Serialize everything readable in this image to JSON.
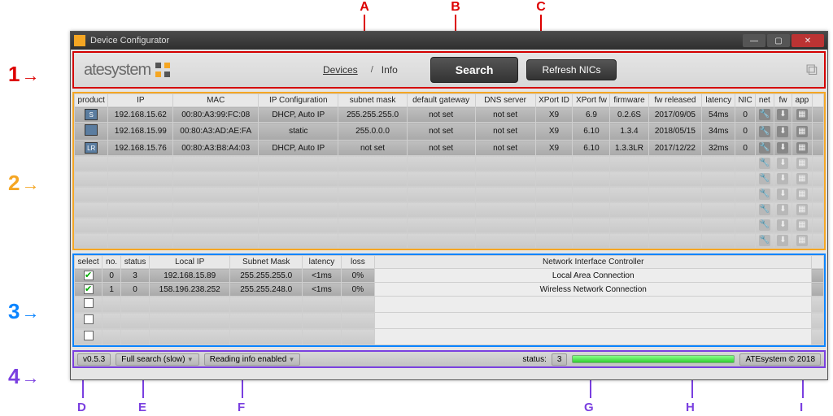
{
  "window": {
    "title": "Device Configurator"
  },
  "header": {
    "logo_text": "atesystem",
    "devices_label": "Devices",
    "info_label": "Info",
    "search_label": "Search",
    "refresh_label": "Refresh NICs"
  },
  "dev_columns": [
    "product",
    "IP",
    "MAC",
    "IP Configuration",
    "subnet mask",
    "default gateway",
    "DNS server",
    "XPort ID",
    "XPort fw",
    "firmware",
    "fw released",
    "latency",
    "NIC",
    "net",
    "fw",
    "app"
  ],
  "devices": [
    {
      "icon": "S",
      "ip": "192.168.15.62",
      "mac": "00:80:A3:99:FC:08",
      "cfg": "DHCP, Auto IP",
      "mask": "255.255.255.0",
      "gw": "not set",
      "dns": "not set",
      "xid": "X9",
      "xfw": "6.9",
      "fw": "0.2.6S",
      "rel": "2017/09/05",
      "lat": "54ms",
      "nic": "0"
    },
    {
      "icon": "",
      "ip": "192.168.15.99",
      "mac": "00:80:A3:AD:AE:FA",
      "cfg": "static",
      "mask": "255.0.0.0",
      "gw": "not set",
      "dns": "not set",
      "xid": "X9",
      "xfw": "6.10",
      "fw": "1.3.4",
      "rel": "2018/05/15",
      "lat": "34ms",
      "nic": "0"
    },
    {
      "icon": "LR",
      "ip": "192.168.15.76",
      "mac": "00:80:A3:B8:A4:03",
      "cfg": "DHCP, Auto IP",
      "mask": "not set",
      "gw": "not set",
      "dns": "not set",
      "xid": "X9",
      "xfw": "6.10",
      "fw": "1.3.3LR",
      "rel": "2017/12/22",
      "lat": "32ms",
      "nic": "0"
    }
  ],
  "nic_columns": [
    "select",
    "no.",
    "status",
    "Local IP",
    "Subnet Mask",
    "latency",
    "loss",
    "Network Interface Controller"
  ],
  "nics": [
    {
      "sel": "✔",
      "no": "0",
      "st": "3",
      "ip": "192.168.15.89",
      "mask": "255.255.255.0",
      "lat": "<1ms",
      "loss": "0%",
      "name": "Local Area Connection"
    },
    {
      "sel": "✔",
      "no": "1",
      "st": "0",
      "ip": "158.196.238.252",
      "mask": "255.255.248.0",
      "lat": "<1ms",
      "loss": "0%",
      "name": "Wireless Network Connection"
    }
  ],
  "status": {
    "version": "v0.5.3",
    "search_mode": "Full search (slow)",
    "reading": "Reading info enabled",
    "status_label": "status:",
    "status_val": "3",
    "copyright": "ATEsystem © 2018"
  },
  "anno": {
    "n1": "1",
    "n2": "2",
    "n3": "3",
    "n4": "4",
    "A": "A",
    "B": "B",
    "C": "C",
    "D": "D",
    "E": "E",
    "F": "F",
    "G": "G",
    "H": "H",
    "I": "I"
  }
}
